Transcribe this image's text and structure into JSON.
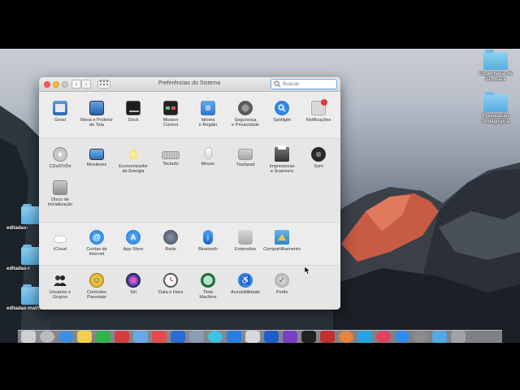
{
  "window": {
    "title": "Preferências do Sistema",
    "search_placeholder": "Buscar"
  },
  "sections": [
    {
      "items": [
        {
          "label": "Geral",
          "icon": "general-icon"
        },
        {
          "label": "Mesa e Protetor\nde Tela",
          "icon": "desktop-screensaver-icon"
        },
        {
          "label": "Dock",
          "icon": "dock-icon"
        },
        {
          "label": "Mission\nControl",
          "icon": "mission-control-icon"
        },
        {
          "label": "Idioma\ne Região",
          "icon": "language-region-icon"
        },
        {
          "label": "Segurança\ne Privacidade",
          "icon": "security-privacy-icon"
        },
        {
          "label": "Spotlight",
          "icon": "spotlight-icon"
        },
        {
          "label": "Notificações",
          "icon": "notifications-icon"
        }
      ]
    },
    {
      "items": [
        {
          "label": "CDs/DVDs",
          "icon": "cd-dvd-icon"
        },
        {
          "label": "Monitores",
          "icon": "displays-icon"
        },
        {
          "label": "Economizador\nde Energia",
          "icon": "energy-saver-icon"
        },
        {
          "label": "Teclado",
          "icon": "keyboard-icon"
        },
        {
          "label": "Mouse",
          "icon": "mouse-icon"
        },
        {
          "label": "Trackpad",
          "icon": "trackpad-icon"
        },
        {
          "label": "Impressoras\ne Scanners",
          "icon": "printers-scanners-icon"
        },
        {
          "label": "Som",
          "icon": "sound-icon"
        },
        {
          "label": "Disco de\nInicialização",
          "icon": "startup-disk-icon"
        }
      ]
    },
    {
      "items": [
        {
          "label": "iCloud",
          "icon": "icloud-icon"
        },
        {
          "label": "Contas de\nInternet",
          "icon": "internet-accounts-icon"
        },
        {
          "label": "App Store",
          "icon": "app-store-icon"
        },
        {
          "label": "Rede",
          "icon": "network-icon"
        },
        {
          "label": "Bluetooth",
          "icon": "bluetooth-icon"
        },
        {
          "label": "Extensões",
          "icon": "extensions-icon"
        },
        {
          "label": "Compartilhamento",
          "icon": "sharing-icon"
        }
      ]
    },
    {
      "items": [
        {
          "label": "Usuários e\nGrupos",
          "icon": "users-groups-icon"
        },
        {
          "label": "Controles\nParentais",
          "icon": "parental-controls-icon"
        },
        {
          "label": "Siri",
          "icon": "siri-icon"
        },
        {
          "label": "Data e Hora",
          "icon": "date-time-icon"
        },
        {
          "label": "Time\nMachine",
          "icon": "time-machine-icon"
        },
        {
          "label": "Acessibilidade",
          "icon": "accessibility-icon"
        },
        {
          "label": "Perfis",
          "icon": "profiles-icon"
        }
      ]
    }
  ],
  "desktop_icons": [
    {
      "label": "Engenharia de\nSoftware"
    },
    {
      "label": "Preparação\nPedagógica"
    },
    {
      "label": "editadas-"
    },
    {
      "label": "editadas-r"
    },
    {
      "label": "editadas-matheus"
    }
  ]
}
